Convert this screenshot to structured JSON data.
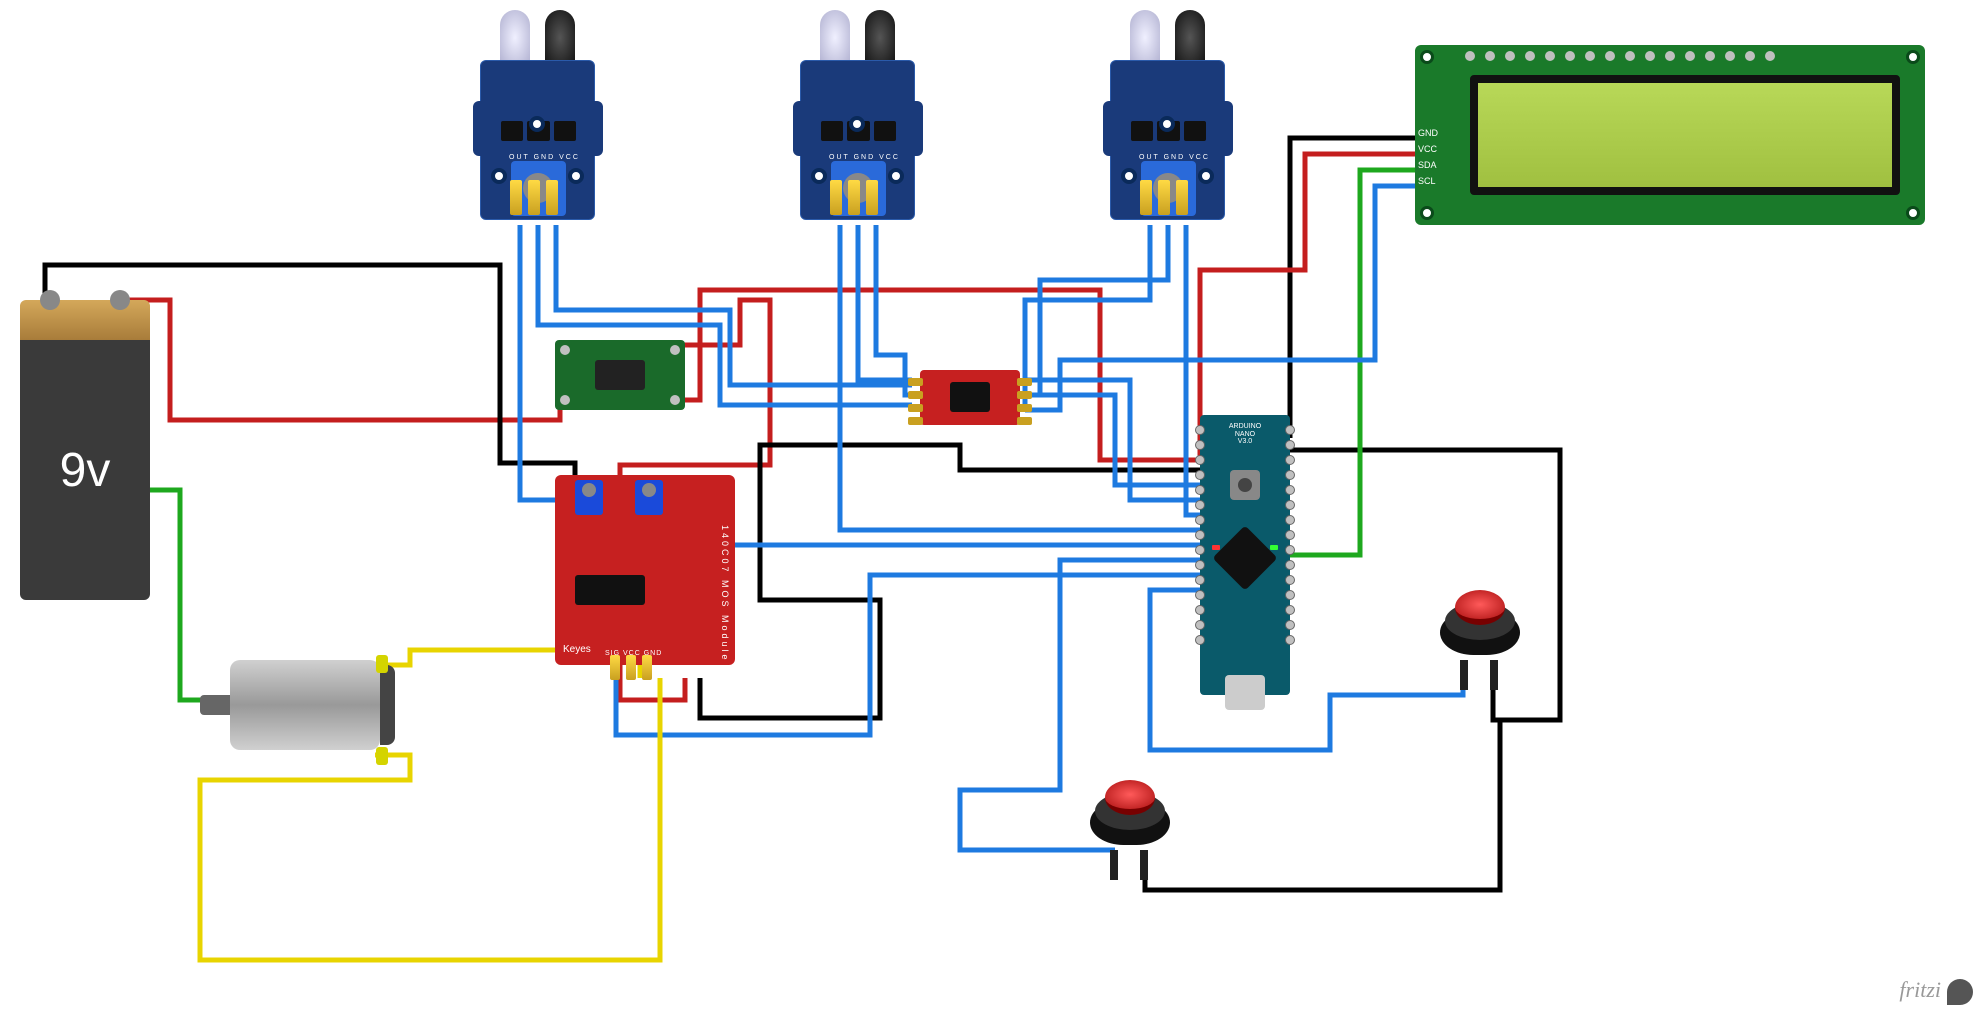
{
  "components": {
    "battery": {
      "label": "9v"
    },
    "ir_sensor": {
      "pin_labels": "OUT GND VCC"
    },
    "buck_converter": {},
    "mosfet_module": {
      "brand": "Keyes",
      "side_label": "140C07 MOS Module",
      "pin_labels": "SIG VCC GND"
    },
    "level_shifter": {},
    "arduino_nano": {
      "label": "ARDUINO\nNANO\nV3.0"
    },
    "lcd": {
      "i2c_labels": "GND\nVCC\nSDA\nSCL"
    },
    "motor": {},
    "push_button_1": {},
    "push_button_2": {}
  },
  "watermark": "fritzi",
  "wire_colors": {
    "power_pos": "#c41e1e",
    "power_neg": "#000000",
    "signal": "#1e7ae0",
    "motor": "#e8d81e",
    "ground_alt": "#1ea81e"
  }
}
